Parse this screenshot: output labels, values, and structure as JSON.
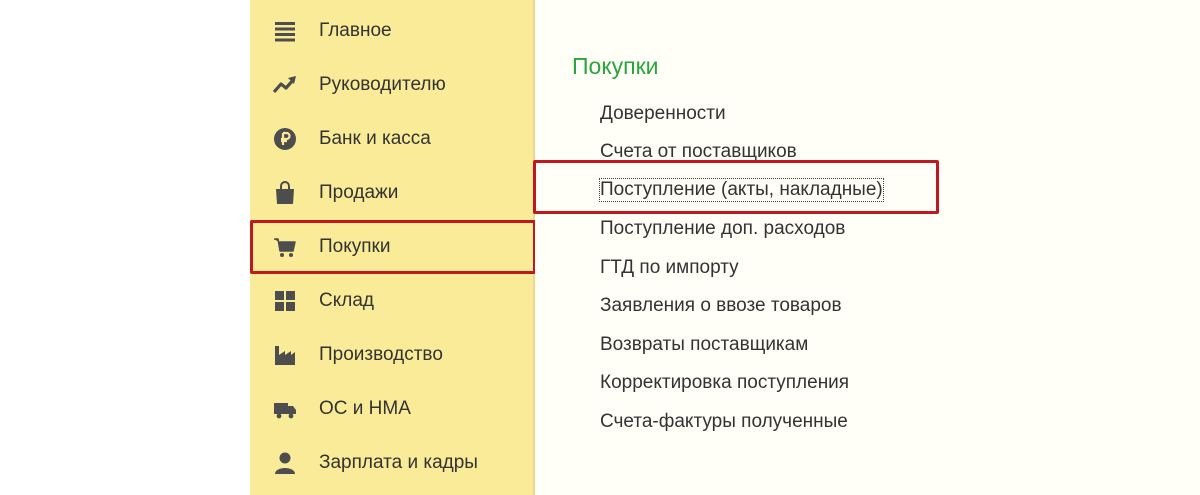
{
  "sidebar": {
    "items": [
      {
        "label": "Главное",
        "icon": "menu-lines-icon"
      },
      {
        "label": "Руководителю",
        "icon": "trend-chart-icon"
      },
      {
        "label": "Банк и касса",
        "icon": "ruble-coin-icon"
      },
      {
        "label": "Продажи",
        "icon": "shopping-bag-icon"
      },
      {
        "label": "Покупки",
        "icon": "shopping-cart-icon"
      },
      {
        "label": "Склад",
        "icon": "warehouse-grid-icon"
      },
      {
        "label": "Производство",
        "icon": "factory-icon"
      },
      {
        "label": "ОС и НМА",
        "icon": "truck-icon"
      },
      {
        "label": "Зарплата и кадры",
        "icon": "person-icon"
      }
    ],
    "active_index": 4
  },
  "panel": {
    "title": "Покупки",
    "links": [
      "Доверенности",
      "Счета от поставщиков",
      "Поступление (акты, накладные)",
      "Поступление доп. расходов",
      "ГТД по импорту",
      "Заявления о ввозе товаров",
      "Возвраты поставщикам",
      "Корректировка поступления",
      "Счета-фактуры полученные"
    ],
    "focused_index": 2
  },
  "colors": {
    "sidebar_bg": "#faeb99",
    "panel_bg": "#fffff7",
    "title_green": "#2aa53c",
    "highlight_red": "#c0181e",
    "text": "#333333",
    "icon": "#4d4d4d"
  }
}
